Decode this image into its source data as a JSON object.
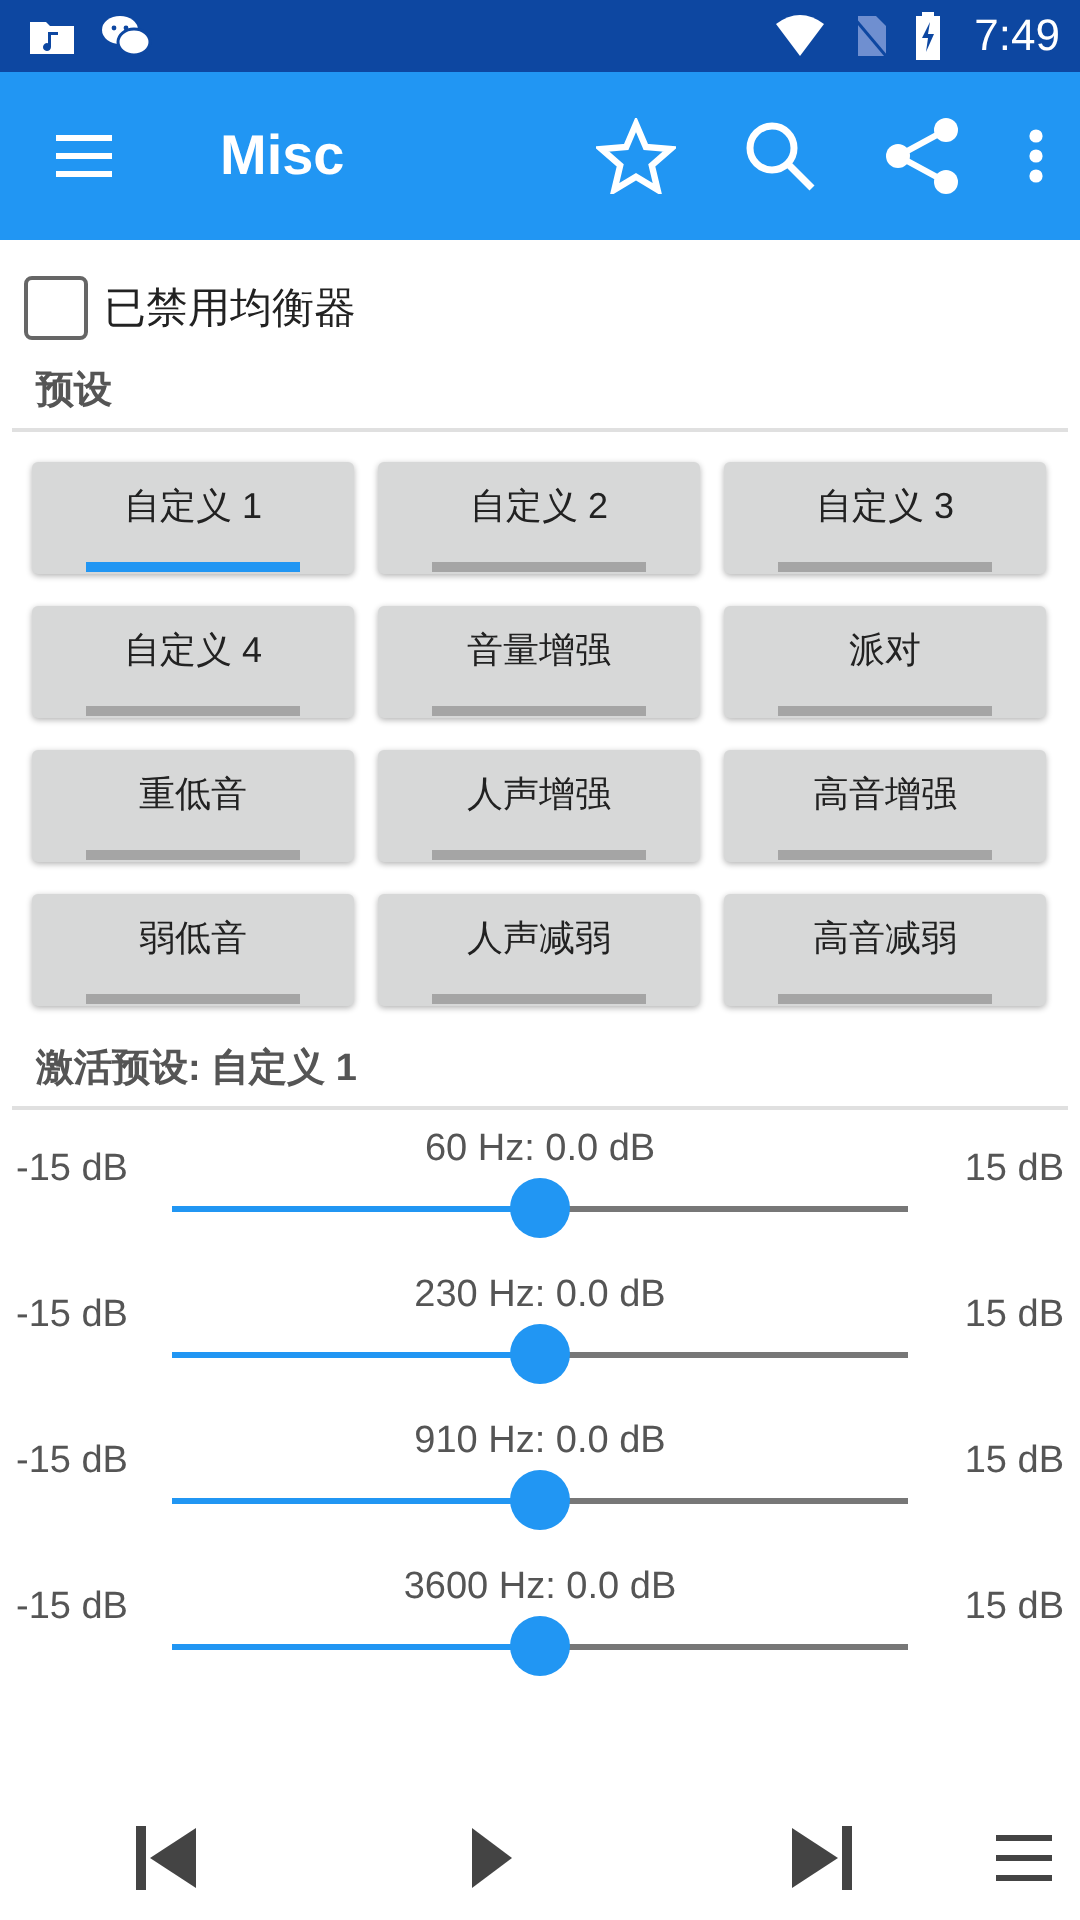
{
  "status_bar": {
    "time": "7:49"
  },
  "toolbar": {
    "title": "Misc"
  },
  "equalizer_toggle": {
    "label": "已禁用均衡器",
    "checked": false
  },
  "presets_header": "预设",
  "presets": [
    {
      "label": "自定义 1",
      "selected": true
    },
    {
      "label": "自定义 2",
      "selected": false
    },
    {
      "label": "自定义 3",
      "selected": false
    },
    {
      "label": "自定义 4",
      "selected": false
    },
    {
      "label": "音量增强",
      "selected": false
    },
    {
      "label": "派对",
      "selected": false
    },
    {
      "label": "重低音",
      "selected": false
    },
    {
      "label": "人声增强",
      "selected": false
    },
    {
      "label": "高音增强",
      "selected": false
    },
    {
      "label": "弱低音",
      "selected": false
    },
    {
      "label": "人声减弱",
      "selected": false
    },
    {
      "label": "高音减弱",
      "selected": false
    }
  ],
  "active_preset": "激活预设: 自定义 1",
  "bands": [
    {
      "label": "60 Hz: 0.0 dB",
      "min": "-15 dB",
      "max": "15 dB",
      "level": 0.5
    },
    {
      "label": "230 Hz: 0.0 dB",
      "min": "-15 dB",
      "max": "15 dB",
      "level": 0.5
    },
    {
      "label": "910 Hz: 0.0 dB",
      "min": "-15 dB",
      "max": "15 dB",
      "level": 0.5
    },
    {
      "label": "3600 Hz: 0.0 dB",
      "min": "-15 dB",
      "max": "15 dB",
      "level": 0.5
    }
  ]
}
